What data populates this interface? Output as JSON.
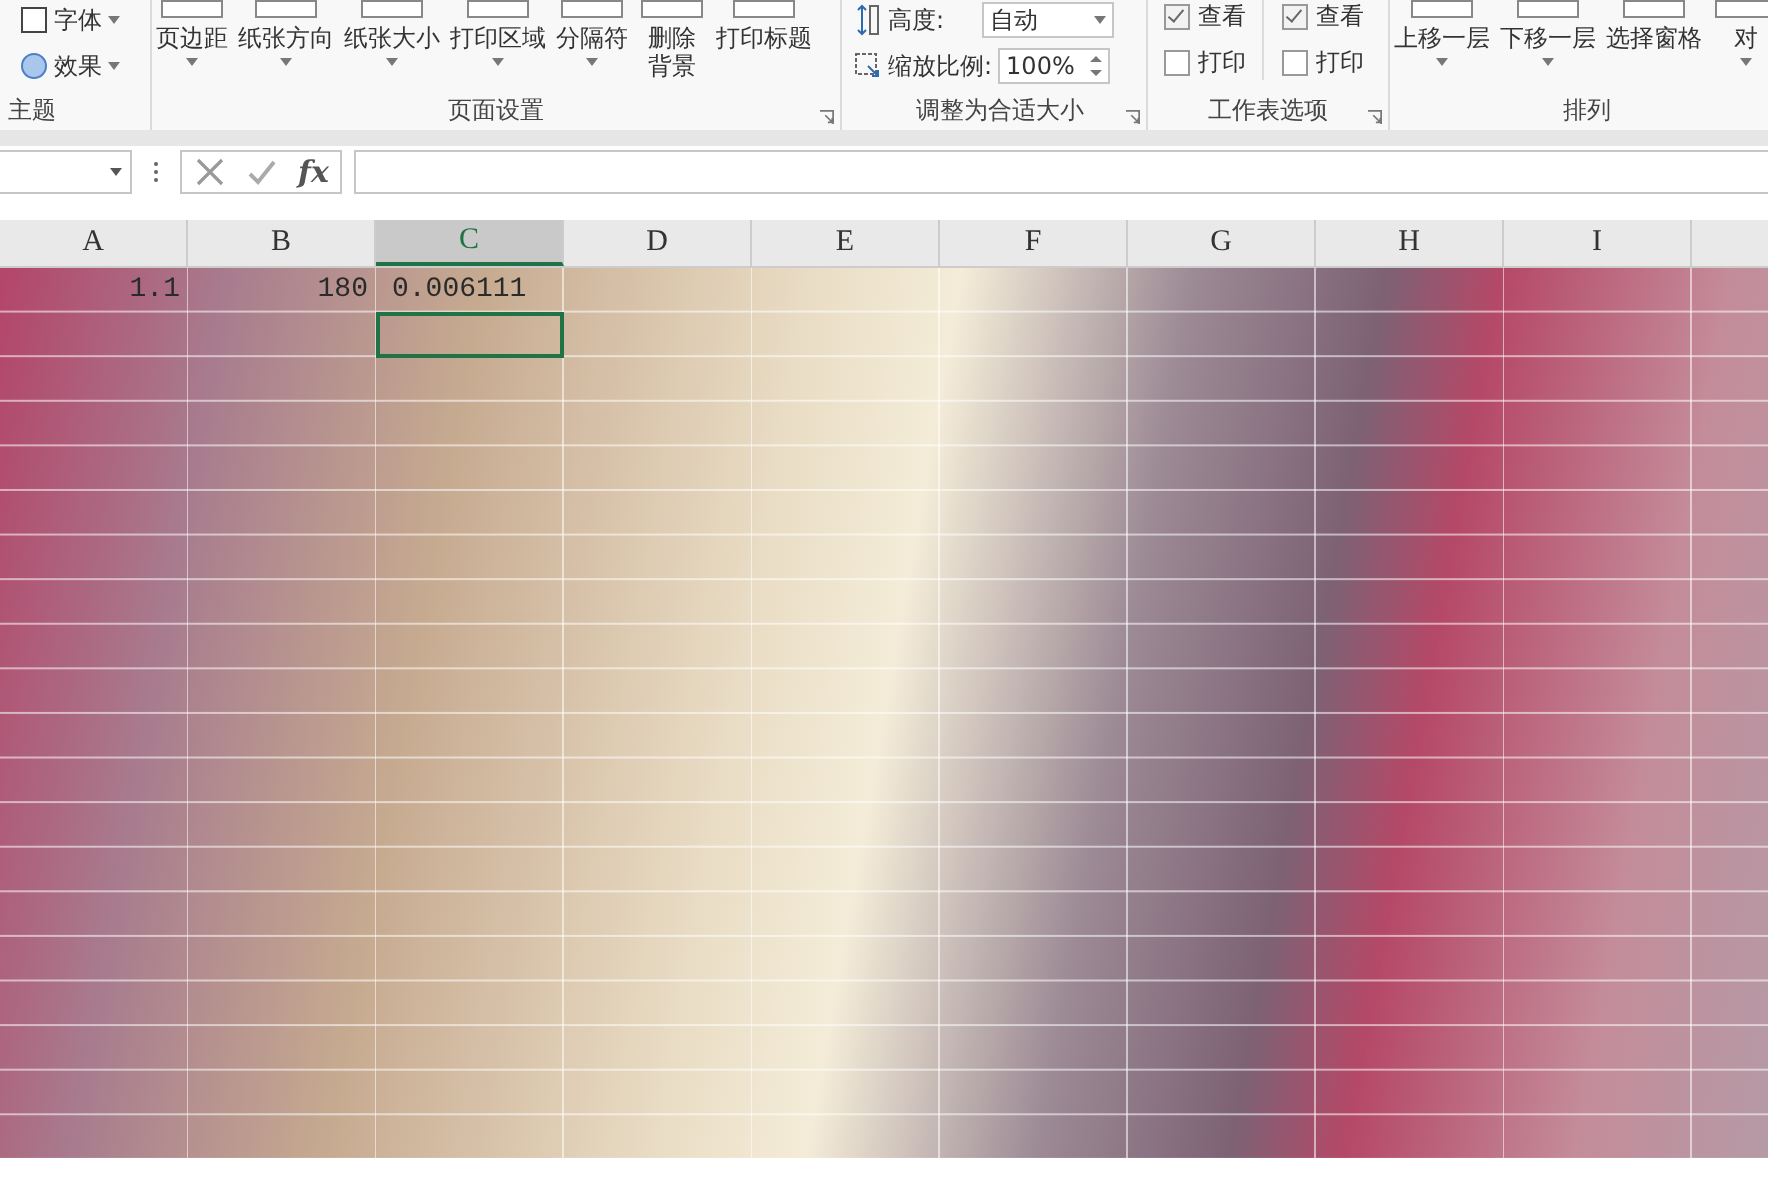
{
  "ribbon": {
    "groups": [
      {
        "label": "主题",
        "launcher": false,
        "items": [
          {
            "kind": "menu",
            "label": "字体"
          },
          {
            "kind": "menu",
            "label": "效果"
          }
        ]
      },
      {
        "label": "页面设置",
        "launcher": true,
        "items": [
          {
            "kind": "large",
            "label": "页边距",
            "caret": true
          },
          {
            "kind": "large",
            "label": "纸张方向",
            "caret": true
          },
          {
            "kind": "large",
            "label": "纸张大小",
            "caret": true
          },
          {
            "kind": "large",
            "label": "打印区域",
            "caret": true
          },
          {
            "kind": "large",
            "label": "分隔符",
            "caret": true
          },
          {
            "kind": "large",
            "label": "删除背景",
            "caret": false
          },
          {
            "kind": "large",
            "label": "打印标题",
            "caret": false
          }
        ]
      },
      {
        "label": "调整为合适大小",
        "launcher": true,
        "items": [
          {
            "kind": "dropdown",
            "label": "高度:",
            "value": "自动"
          },
          {
            "kind": "spinner",
            "label": "缩放比例:",
            "value": "100%"
          }
        ]
      },
      {
        "label": "工作表选项",
        "launcher": true,
        "items": [
          {
            "kind": "checks",
            "checks": [
              {
                "label": "查看",
                "checked": true
              },
              {
                "label": "打印",
                "checked": false
              }
            ]
          },
          {
            "kind": "checks",
            "checks": [
              {
                "label": "查看",
                "checked": true
              },
              {
                "label": "打印",
                "checked": false
              }
            ]
          }
        ]
      },
      {
        "label": "排列",
        "launcher": false,
        "items": [
          {
            "kind": "large",
            "label": "上移一层",
            "caret": true
          },
          {
            "kind": "large",
            "label": "下移一层",
            "caret": true
          },
          {
            "kind": "large",
            "label": "选择窗格",
            "caret": false
          },
          {
            "kind": "large",
            "label": "对",
            "caret": true
          }
        ]
      }
    ]
  },
  "formula_bar": {
    "function_button": "fx"
  },
  "columns": [
    {
      "label": "A",
      "selected": false
    },
    {
      "label": "B",
      "selected": false
    },
    {
      "label": "C",
      "selected": true
    },
    {
      "label": "D",
      "selected": false
    },
    {
      "label": "E",
      "selected": false
    },
    {
      "label": "F",
      "selected": false
    },
    {
      "label": "G",
      "selected": false
    },
    {
      "label": "H",
      "selected": false
    },
    {
      "label": "I",
      "selected": false
    }
  ],
  "rows": [
    {
      "active": false,
      "cells": [
        "1.1",
        "180",
        "0.006111"
      ]
    },
    {
      "active": true
    }
  ]
}
